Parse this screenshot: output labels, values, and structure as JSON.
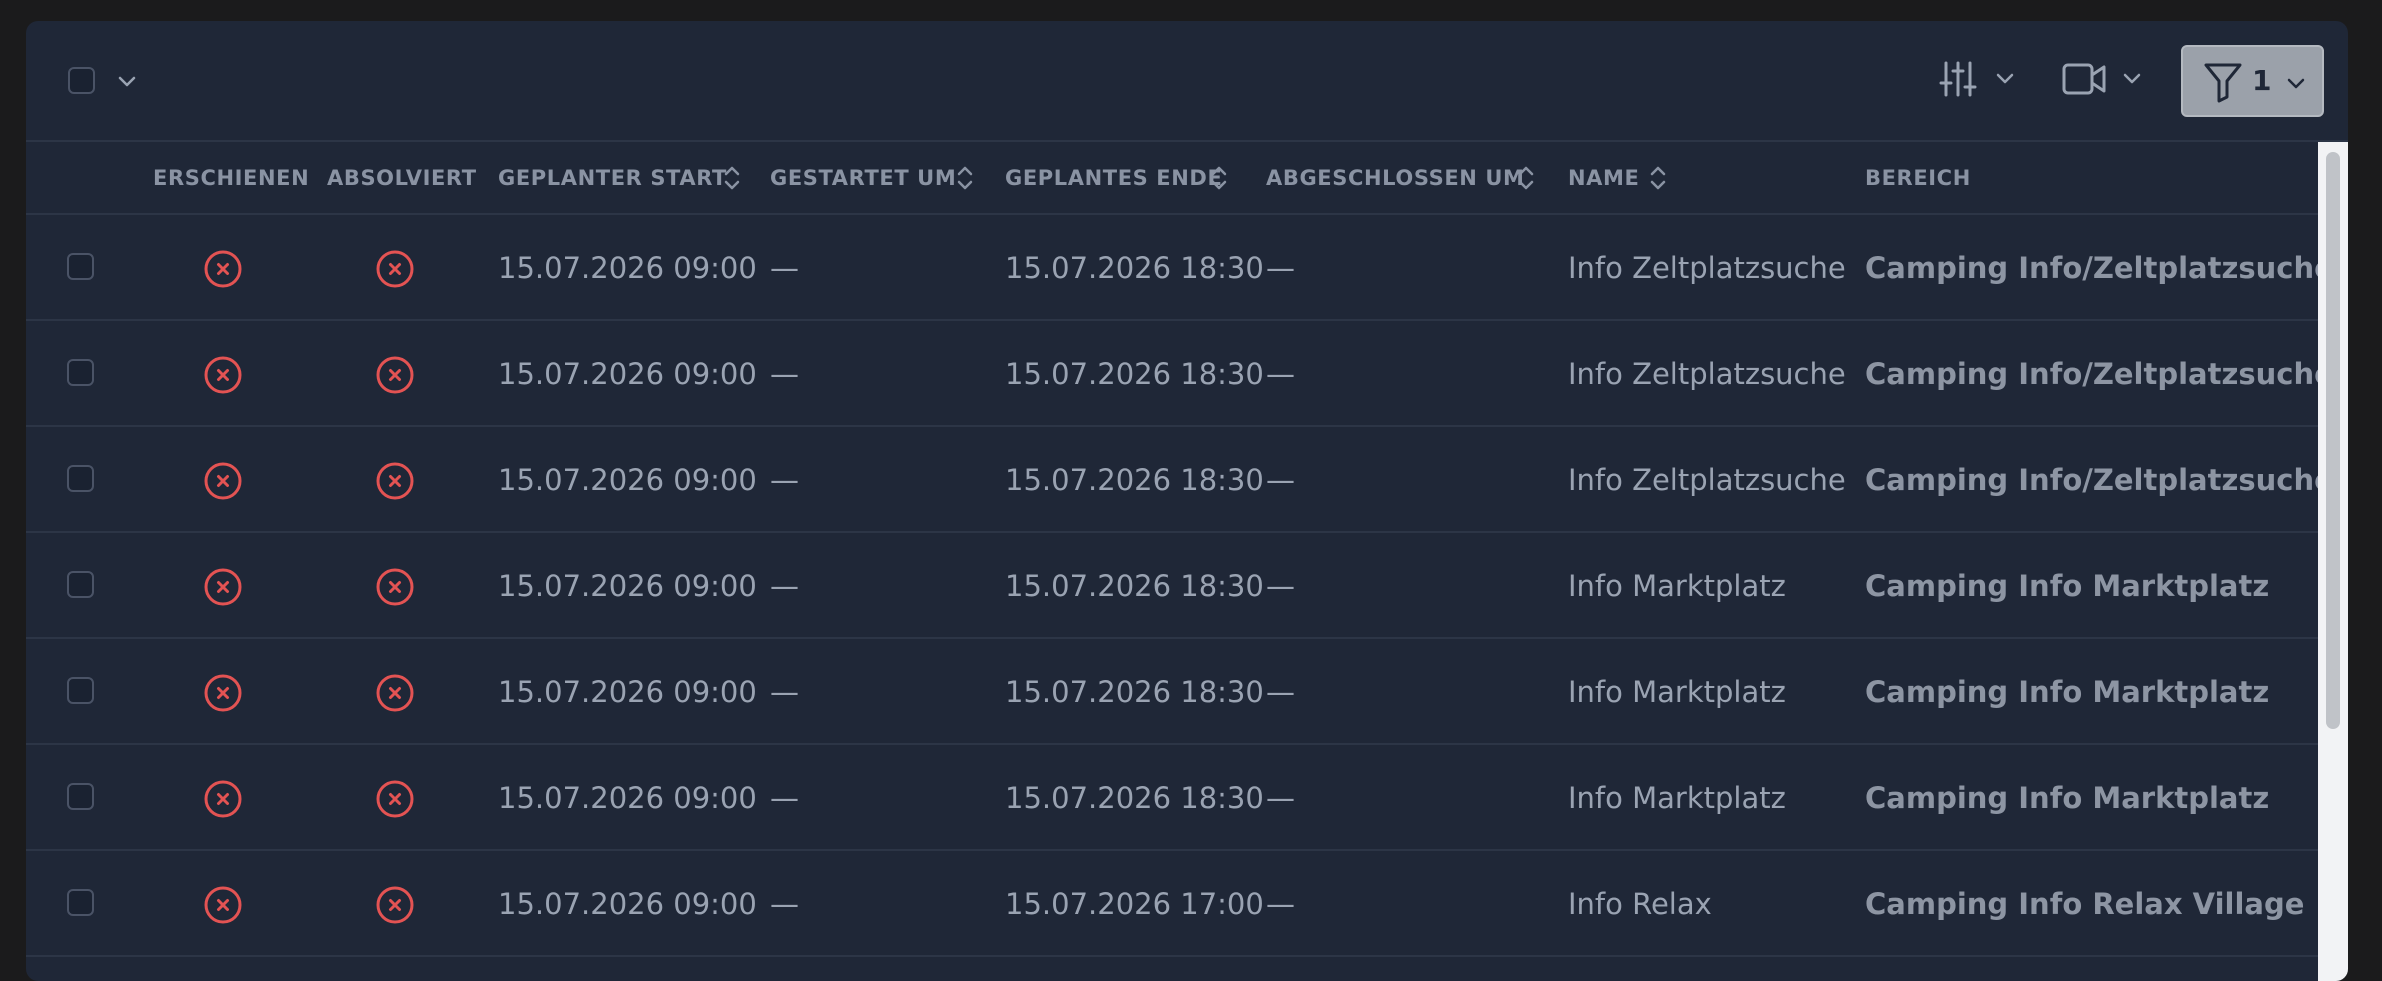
{
  "colors": {
    "panel": "#1f2737",
    "status_no": "#e35353",
    "filter_bg": "#9ba1aa"
  },
  "toolbar": {
    "select_all_icon": "checkbox-icon",
    "columns_icon": "sliders-icon",
    "view_icon": "video-camera-icon",
    "filter_icon": "funnel-icon",
    "filter_count": "1"
  },
  "table": {
    "headers": {
      "erschienen": "ERSCHIENEN",
      "absolviert": "ABSOLVIERT",
      "geplanter_start": "GEPLANTER START",
      "gestartet_um": "GESTARTET UM",
      "geplantes_ende": "GEPLANTES ENDE",
      "abgeschlossen_um": "ABGESCHLOSSEN UM",
      "name": "NAME",
      "bereich": "BEREICH"
    },
    "rows": [
      {
        "start": "15.07.2026 09:00",
        "gestartet": "—",
        "ende": "15.07.2026 18:30",
        "abgeschlossen": "—",
        "name": "Info Zeltplatzsuche",
        "bereich": "Camping Info/Zeltplatzsuche",
        "erschienen": "no",
        "absolviert": "no"
      },
      {
        "start": "15.07.2026 09:00",
        "gestartet": "—",
        "ende": "15.07.2026 18:30",
        "abgeschlossen": "—",
        "name": "Info Zeltplatzsuche",
        "bereich": "Camping Info/Zeltplatzsuche",
        "erschienen": "no",
        "absolviert": "no"
      },
      {
        "start": "15.07.2026 09:00",
        "gestartet": "—",
        "ende": "15.07.2026 18:30",
        "abgeschlossen": "—",
        "name": "Info Zeltplatzsuche",
        "bereich": "Camping Info/Zeltplatzsuche",
        "erschienen": "no",
        "absolviert": "no"
      },
      {
        "start": "15.07.2026 09:00",
        "gestartet": "—",
        "ende": "15.07.2026 18:30",
        "abgeschlossen": "—",
        "name": "Info Marktplatz",
        "bereich": "Camping Info Marktplatz",
        "erschienen": "no",
        "absolviert": "no"
      },
      {
        "start": "15.07.2026 09:00",
        "gestartet": "—",
        "ende": "15.07.2026 18:30",
        "abgeschlossen": "—",
        "name": "Info Marktplatz",
        "bereich": "Camping Info Marktplatz",
        "erschienen": "no",
        "absolviert": "no"
      },
      {
        "start": "15.07.2026 09:00",
        "gestartet": "—",
        "ende": "15.07.2026 18:30",
        "abgeschlossen": "—",
        "name": "Info Marktplatz",
        "bereich": "Camping Info Marktplatz",
        "erschienen": "no",
        "absolviert": "no"
      },
      {
        "start": "15.07.2026 09:00",
        "gestartet": "—",
        "ende": "15.07.2026 17:00",
        "abgeschlossen": "—",
        "name": "Info Relax",
        "bereich": "Camping Info Relax Village",
        "erschienen": "no",
        "absolviert": "no"
      }
    ]
  }
}
